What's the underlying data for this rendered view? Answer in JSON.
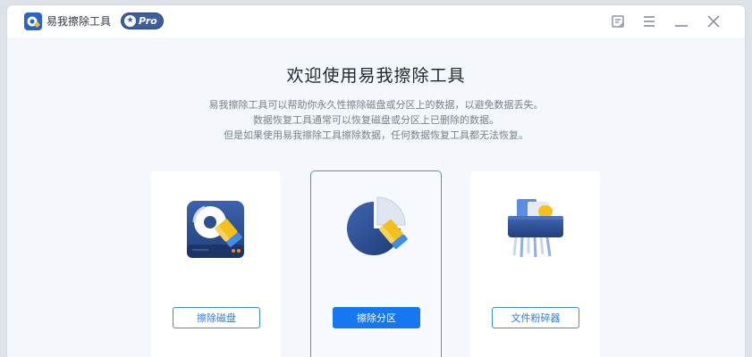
{
  "app": {
    "title": "易我擦除工具",
    "badge": "Pro"
  },
  "titlebar": {
    "icons": [
      "feedback-icon",
      "menu-icon",
      "minimize-icon",
      "close-icon"
    ]
  },
  "main": {
    "heading": "欢迎使用易我擦除工具",
    "description": [
      "易我擦除工具可以帮助你永久性擦除磁盘或分区上的数据，以避免数据丢失。",
      "数据恢复工具通常可以恢复磁盘或分区上已删除的数据。",
      "但是如果使用易我擦除工具擦除数据，任何数据恢复工具都无法恢复。"
    ],
    "cards": [
      {
        "button": "擦除磁盘",
        "icon": "disk-eraser-icon",
        "selected": false
      },
      {
        "button": "擦除分区",
        "icon": "partition-eraser-icon",
        "selected": true
      },
      {
        "button": "文件粉碎器",
        "icon": "file-shredder-icon",
        "selected": false
      }
    ]
  },
  "colors": {
    "accent": "#1677f0",
    "navy": "#2f4f8c",
    "eraser_yellow": "#f5bf1d",
    "background": "#f4f7fb"
  }
}
